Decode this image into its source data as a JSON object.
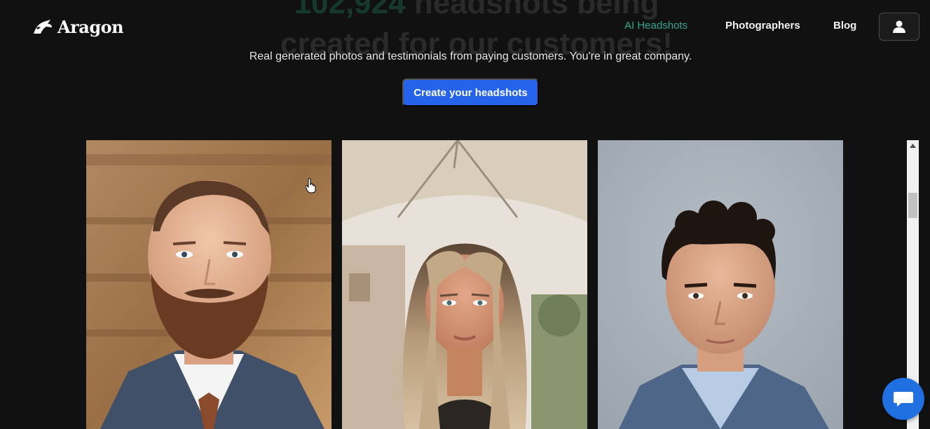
{
  "hero": {
    "heading_line1_number": "102,924",
    "heading_line1_text": " headshots being",
    "heading_line2": "created for our customers!",
    "subtitle": "Real generated photos and testimonials from paying customers. You're in great company.",
    "cta_label": "Create your headshots"
  },
  "header": {
    "logo_text": "Aragon",
    "nav": {
      "ai_headshots": "AI Headshots",
      "photographers": "Photographers",
      "blog": "Blog"
    },
    "account_icon": "user-icon"
  },
  "colors": {
    "background": "#111111",
    "accent_green": "#2ca88a",
    "cta_blue": "#2563eb",
    "chat_blue": "#1f6fe0"
  },
  "gallery": {
    "photos": [
      {
        "subject": "bearded man in suit",
        "icon": "photo"
      },
      {
        "subject": "woman with long blonde hair",
        "icon": "photo"
      },
      {
        "subject": "dark-haired man in blue blazer",
        "icon": "photo"
      }
    ]
  },
  "chat": {
    "icon": "chat-bubble-icon"
  }
}
